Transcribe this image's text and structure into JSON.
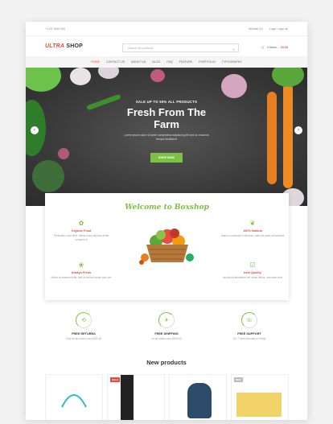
{
  "topbar": {
    "phone": "+1 00 1900 000",
    "wishlist": "Wishlist (0)",
    "login": "Login / sign up"
  },
  "header": {
    "logo_part1": "ULTRA",
    "logo_part2": "SHOP",
    "search_placeholder": "Search for products",
    "cart_label": "0 items -",
    "cart_price": "£0.00"
  },
  "nav": [
    "Home",
    "Contact Us",
    "About us",
    "Blog",
    "FAQ",
    "Feature",
    "Portfolio",
    "Typography"
  ],
  "hero": {
    "subtitle": "SALE UP TO 50% ALL PRODUCTS",
    "title_line1": "Fresh From The",
    "title_line2": "Farm",
    "description": "Lorem ipsum dolor sit amet consectetur adipiscing elit sed do eiusmod tempor incididunt",
    "button": "SHOP NOW"
  },
  "welcome": {
    "title": "Welcome to Boxshop",
    "features": [
      {
        "title": "Organic Food",
        "desc": "Perfection once here, officia id aut laborum tenet venamin a"
      },
      {
        "title": "100% Natural",
        "desc": "ullamco occaecat id elit esse, dolor sit amet consectetur"
      },
      {
        "title": "Always Fresh",
        "desc": "officia ut deserunt elite, sed do dolore kerum test lure"
      },
      {
        "title": "best Quality",
        "desc": "hendrerit elementum vel, ellam litibus, duis aute irure"
      }
    ]
  },
  "services": [
    {
      "title": "FREE RETURNS",
      "desc": "Only for all orders over $100.00"
    },
    {
      "title": "FREE SHIPPING",
      "desc": "on all orders over $100.00"
    },
    {
      "title": "FREE SUPPORT",
      "desc": "24 / 7 from Monday to Friday"
    }
  ],
  "new_products": {
    "title": "New products",
    "badges": [
      "SALE",
      "NEW"
    ]
  },
  "colors": {
    "accent": "#e84c3d",
    "green": "#7cc143"
  }
}
